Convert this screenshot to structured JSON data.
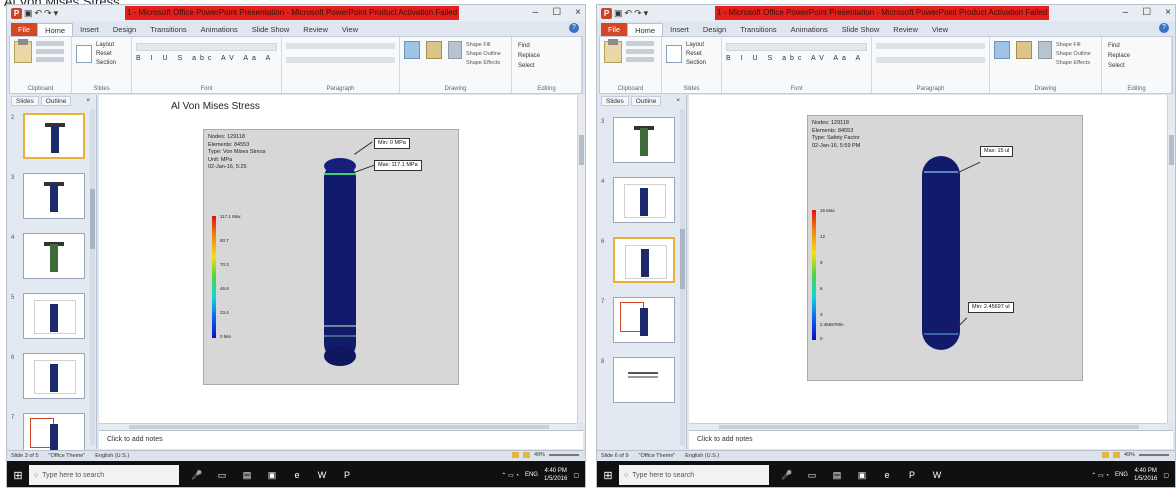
{
  "caption": "Al Von Mises Stress",
  "window": {
    "title": "1 - Microsoft Office PowerPoint Presentation - Microsoft PowerPoint Product Activation Failed",
    "min": "–",
    "max": "☐",
    "close": "×"
  },
  "tabs": [
    "File",
    "Home",
    "Insert",
    "Design",
    "Transitions",
    "Animations",
    "Slide Show",
    "Review",
    "View"
  ],
  "ribbon": {
    "clipboard": {
      "label": "Clipboard",
      "paste": "Paste"
    },
    "slides": {
      "label": "Slides",
      "new_slide": "New Slide",
      "layout": "Layout",
      "reset": "Reset",
      "section": "Section"
    },
    "font": {
      "label": "Font",
      "format": "B I U S abc AV Aa A"
    },
    "paragraph": {
      "label": "Paragraph"
    },
    "drawing": {
      "label": "Drawing",
      "shapes": "Shapes",
      "arrange": "Arrange",
      "quick_styles": "Quick Styles",
      "fill": "Shape Fill",
      "outline": "Shape Outline",
      "effects": "Shape Effects"
    },
    "editing": {
      "label": "Editing",
      "find": "Find",
      "replace": "Replace",
      "select": "Select"
    }
  },
  "pane_tabs": {
    "slides": "Slides",
    "outline": "Outline",
    "close": "×"
  },
  "notes_placeholder": "Click to add notes",
  "left": {
    "slide_title": "Al Von Mises Stress",
    "info": [
      "Nodes: 129118",
      "Elements: 84553",
      "Type: Von Mises Stress",
      "Unit: MPa",
      "02-Jan-16, 5:25"
    ],
    "legend": [
      "117.1 Max",
      "93.7",
      "70.3",
      "46.8",
      "23.4",
      "0 Min"
    ],
    "callout_max": "Max: 117.1 MPa",
    "callout_min": "Min: 0 MPa",
    "status": "Slide 3 of 5",
    "theme": "\"Office Theme\"",
    "language": "English (U.S.)",
    "zoom": "49%"
  },
  "right": {
    "info": [
      "Nodes: 129118",
      "Elements: 84553",
      "Type: Safety Factor",
      "02-Jan-16, 5:59 PM"
    ],
    "legend": [
      "15 Max",
      "12",
      "9",
      "6",
      "3",
      "2.45697Min",
      "0"
    ],
    "callout_max": "Max: 15 ul",
    "callout_min": "Min: 2.45697 ul",
    "status": "Slide 6 of 9",
    "theme": "\"Office Theme\"",
    "language": "English (U.S.)",
    "zoom": "49%"
  },
  "taskbar": {
    "search": "Type here to search",
    "lang": "ENG",
    "left_time": "4:40 PM",
    "right_time": "4:40 PM",
    "date": "1/5/2016"
  },
  "colors": {
    "title_bar_accent": "#e3201b",
    "file_tab": "#d24726",
    "fea_body": "#121a6b",
    "taskbar": "#101010"
  }
}
